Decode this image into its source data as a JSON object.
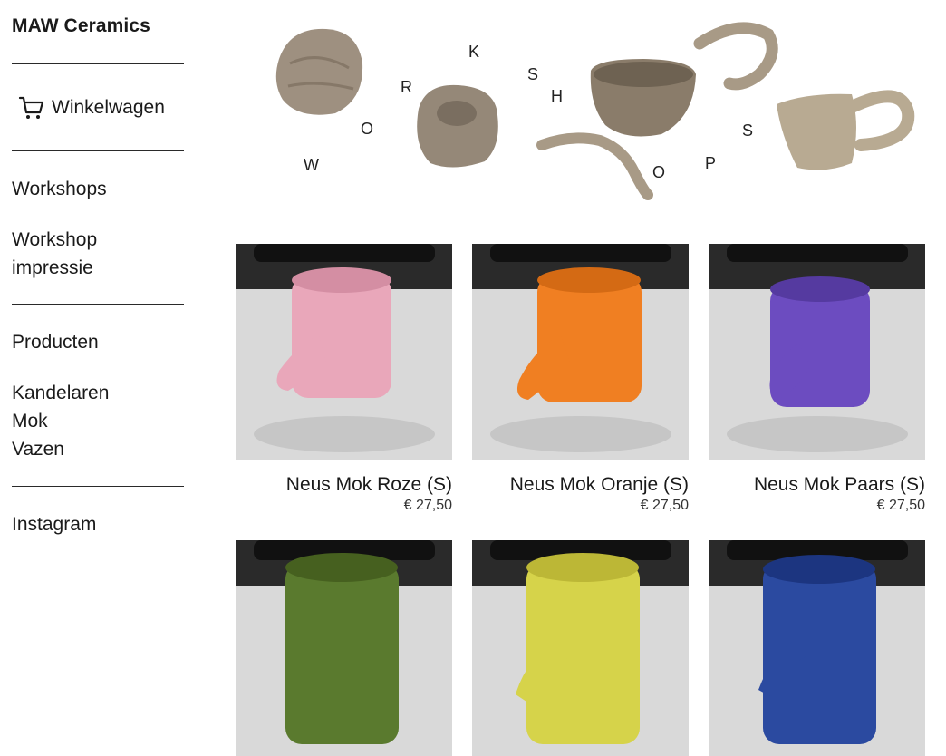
{
  "brand": "MAW Ceramics",
  "cart_label": "Winkelwagen",
  "nav": {
    "workshops": "Workshops",
    "workshop_impressie_line1": "Workshop",
    "workshop_impressie_line2": "impressie",
    "producten": "Producten",
    "kandelaren": "Kandelaren",
    "mok": "Mok",
    "vazen": "Vazen",
    "instagram": "Instagram"
  },
  "banner_letters": [
    "W",
    "O",
    "R",
    "K",
    "S",
    "H",
    "O",
    "P",
    "S"
  ],
  "products": [
    {
      "name": "Neus Mok Roze (S)",
      "price": "€ 27,50",
      "color": "#e9a7ba"
    },
    {
      "name": "Neus Mok Oranje (S)",
      "price": "€ 27,50",
      "color": "#f07f22"
    },
    {
      "name": "Neus Mok Paars (S)",
      "price": "€ 27,50",
      "color": "#6c4cc0"
    },
    {
      "name": "",
      "price": "",
      "color": "#5a7a2e"
    },
    {
      "name": "",
      "price": "",
      "color": "#d6d34a"
    },
    {
      "name": "",
      "price": "",
      "color": "#2b4aa0"
    }
  ]
}
